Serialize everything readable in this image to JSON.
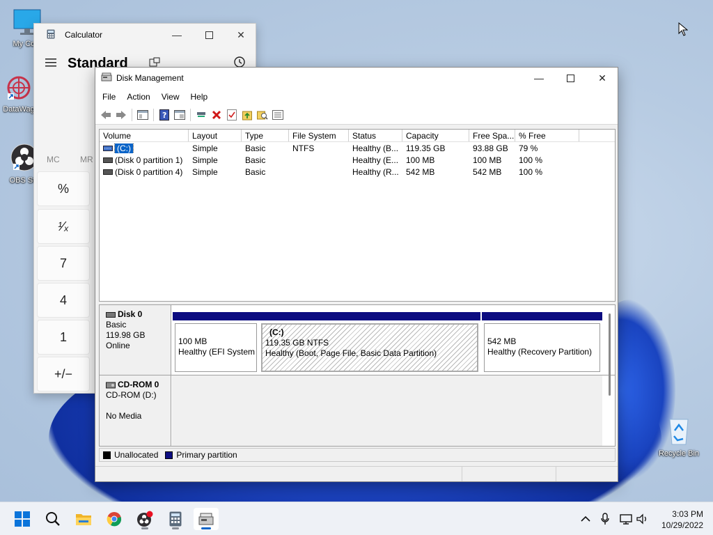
{
  "desktop": {
    "icons": [
      {
        "label": "My Com"
      },
      {
        "label": "DataWag"
      },
      {
        "label": "OBS Stu"
      },
      {
        "label": "Recycle Bin"
      }
    ]
  },
  "calculator": {
    "title": "Calculator",
    "mode": "Standard",
    "memory": [
      "MC",
      "MR"
    ],
    "keys": [
      "%",
      "¹⁄ₓ",
      "7",
      "4",
      "1",
      "+/−"
    ]
  },
  "disk_management": {
    "title": "Disk Management",
    "menu": [
      "File",
      "Action",
      "View",
      "Help"
    ],
    "columns": [
      "Volume",
      "Layout",
      "Type",
      "File System",
      "Status",
      "Capacity",
      "Free Spa...",
      "% Free"
    ],
    "volumes": [
      {
        "volume": "(C:)",
        "layout": "Simple",
        "type": "Basic",
        "fs": "NTFS",
        "status": "Healthy (B...",
        "capacity": "119.35 GB",
        "free": "93.88 GB",
        "pct": "79 %"
      },
      {
        "volume": "(Disk 0 partition 1)",
        "layout": "Simple",
        "type": "Basic",
        "fs": "",
        "status": "Healthy (E...",
        "capacity": "100 MB",
        "free": "100 MB",
        "pct": "100 %"
      },
      {
        "volume": "(Disk 0 partition 4)",
        "layout": "Simple",
        "type": "Basic",
        "fs": "",
        "status": "Healthy (R...",
        "capacity": "542 MB",
        "free": "542 MB",
        "pct": "100 %"
      }
    ],
    "disk0": {
      "name": "Disk 0",
      "type": "Basic",
      "size": "119.98 GB",
      "state": "Online",
      "partitions": [
        {
          "title": "",
          "line1": "100 MB",
          "line2": "Healthy (EFI System P"
        },
        {
          "title": "(C:)",
          "line1": "119.35 GB NTFS",
          "line2": "Healthy (Boot, Page File, Basic Data Partition)"
        },
        {
          "title": "",
          "line1": "542 MB",
          "line2": "Healthy (Recovery Partition)"
        }
      ]
    },
    "cdrom": {
      "name": "CD-ROM 0",
      "drive": "CD-ROM (D:)",
      "media": "No Media"
    },
    "legend": {
      "unallocated": "Unallocated",
      "primary": "Primary partition"
    }
  },
  "taskbar": {
    "time": "3:03 PM",
    "date": "10/29/2022"
  },
  "colors": {
    "partition_bar": "#0c0c80",
    "selection": "#0a64c8"
  }
}
